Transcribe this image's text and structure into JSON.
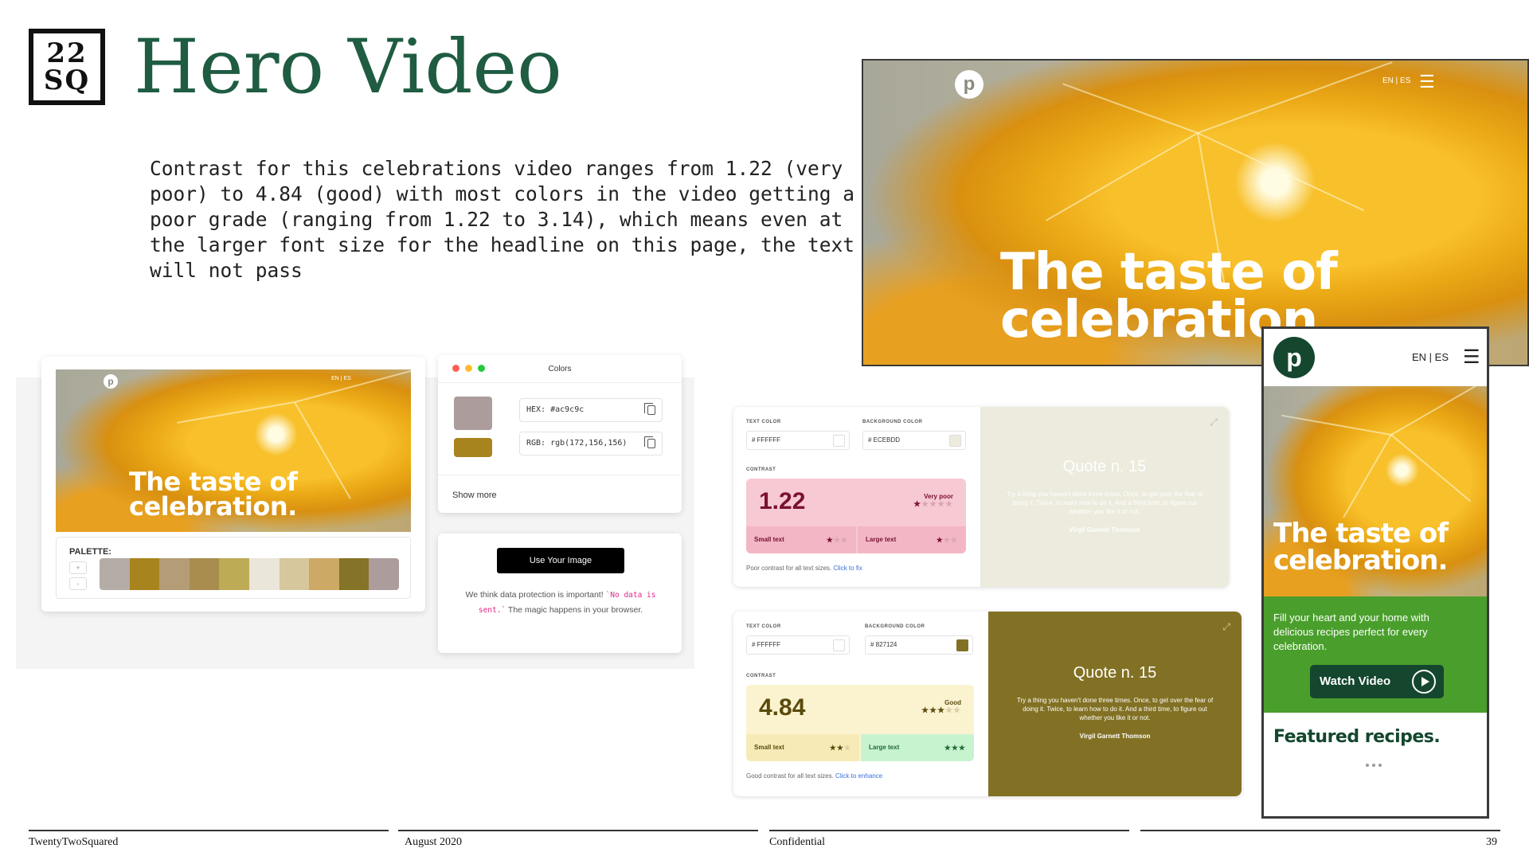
{
  "logo": {
    "line1": "22",
    "line2": "SQ"
  },
  "title": "Hero Video",
  "intro": "Contrast for this celebrations video ranges from 1.22 (very poor) to 4.84 (good) with most colors in the video getting a poor grade (ranging from 1.22 to 3.14), which means even at the larger font size for the headline on this page, the text will not pass",
  "hero_big": {
    "logo_icon": "publix-p-logo-icon",
    "lang": "EN | ES",
    "menu_icon": "hamburger-menu-icon",
    "headline_line1": "The taste of",
    "headline_line2": "celebration"
  },
  "palette_tool": {
    "preview": {
      "lang": "EN | ES",
      "headline_line1": "The taste of",
      "headline_line2": "celebration."
    },
    "palette_label": "PALETTE:",
    "plus": "+",
    "minus": "-",
    "swatches": [
      "#b3ada5",
      "#a8841e",
      "#b39c76",
      "#a88d4f",
      "#bdab55",
      "#ebe6da",
      "#d6c79c",
      "#cca965",
      "#857327",
      "#ac9c9c"
    ],
    "colors_panel": {
      "title": "Colors",
      "hex": "HEX: #ac9c9c",
      "rgb": "RGB: rgb(172,156,156)",
      "show_more": "Show more",
      "swatch_primary": "#ac9c9c",
      "swatch_secondary": "#a8841e"
    },
    "upload": {
      "button": "Use Your Image",
      "note_before": "We think data protection is important! ",
      "note_code": "`No data is sent.`",
      "note_after": " The magic happens in your browser."
    }
  },
  "checker_poor": {
    "text_color_label": "TEXT COLOR",
    "text_color": "# FFFFFF",
    "background_label": "BACKGROUND COLOR",
    "background_color": "# ECEBDD",
    "contrast_label": "CONTRAST",
    "score": "1.22",
    "grade": "Very poor",
    "grade_stars": "★★★★★",
    "small_text": "Small text",
    "small_stars": "★★★",
    "large_text": "Large text",
    "large_stars": "★★★",
    "note": "Poor contrast for all text sizes. ",
    "note_link": "Click to fix",
    "quote_title": "Quote n. 15",
    "quote_body": "Try a thing you haven't done three times. Once, to get over the fear of doing it. Twice, to learn how to do it. And a third time, to figure out whether you like it or not.",
    "quote_author": "Virgil Garnett Thomson",
    "bg_hex": "#ecebdd",
    "accent": "#f7c9d3"
  },
  "checker_good": {
    "text_color_label": "TEXT COLOR",
    "text_color": "# FFFFFF",
    "background_label": "BACKGROUND COLOR",
    "background_color": "# 827124",
    "contrast_label": "CONTRAST",
    "score": "4.84",
    "grade": "Good",
    "grade_stars": "★★★★★",
    "small_text": "Small text",
    "small_stars": "★★★",
    "large_text": "Large text",
    "large_stars": "★★★",
    "note": "Good contrast for all text sizes. ",
    "note_link": "Click to enhance",
    "quote_title": "Quote n. 15",
    "quote_body": "Try a thing you haven't done three times. Once, to get over the fear of doing it. Twice, to learn how to do it. And a third time, to figure out whether you like it or not.",
    "quote_author": "Virgil Garnett Thomson",
    "bg_hex": "#827124",
    "accent": "#fbf3d0"
  },
  "mobile": {
    "lang": "EN | ES",
    "headline_line1": "The taste of",
    "headline_line2": "celebration.",
    "description": "Fill your heart and your home with delicious recipes perfect for every celebration.",
    "watch_button": "Watch Video",
    "featured": "Featured recipes."
  },
  "footer": {
    "company": "TwentyTwoSquared",
    "date": "August 2020",
    "confidential": "Confidential",
    "page": "39"
  }
}
